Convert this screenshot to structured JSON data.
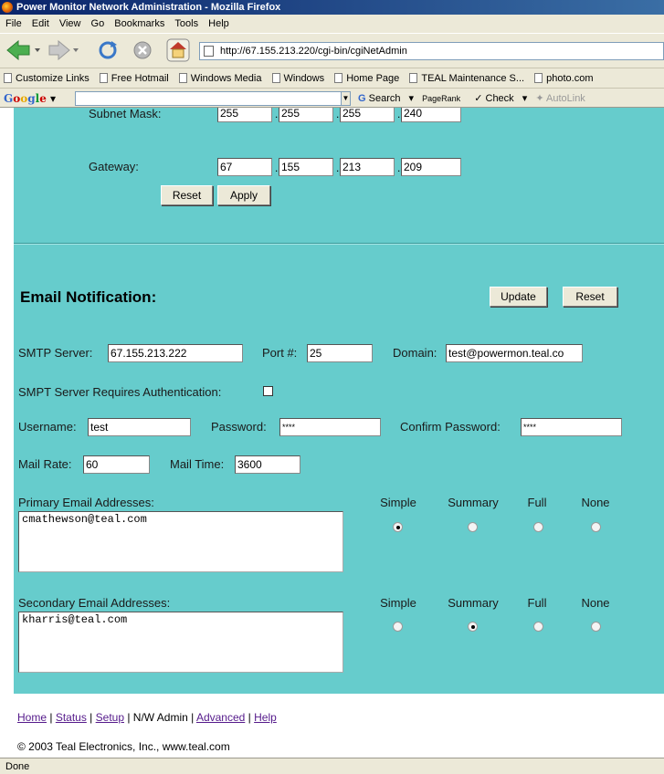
{
  "window": {
    "title": "Power Monitor Network Administration - Mozilla Firefox"
  },
  "menu": [
    "File",
    "Edit",
    "View",
    "Go",
    "Bookmarks",
    "Tools",
    "Help"
  ],
  "address": {
    "url": "http://67.155.213.220/cgi-bin/cgiNetAdmin"
  },
  "bookmarks": [
    "Customize Links",
    "Free Hotmail",
    "Windows Media",
    "Windows",
    "Home Page",
    "TEAL Maintenance S...",
    "photo.com"
  ],
  "googlebar": {
    "search": "Search",
    "pagerank": "PageRank",
    "check": "Check",
    "autolink": "AutoLink"
  },
  "network": {
    "subnet_label": "Subnet Mask:",
    "subnet": [
      "255",
      "255",
      "255",
      "240"
    ],
    "gateway_label": "Gateway:",
    "gateway": [
      "67",
      "155",
      "213",
      "209"
    ],
    "reset": "Reset",
    "apply": "Apply"
  },
  "email": {
    "title": "Email Notification:",
    "update": "Update",
    "reset": "Reset",
    "smtp_label": "SMTP Server:",
    "smtp": "67.155.213.222",
    "port_label": "Port #:",
    "port": "25",
    "domain_label": "Domain:",
    "domain": "test@powermon.teal.co",
    "auth_label": "SMPT Server Requires Authentication:",
    "auth_checked": false,
    "username_label": "Username:",
    "username": "test",
    "password_label": "Password:",
    "password": "****",
    "confirm_label": "Confirm Password:",
    "confirm": "****",
    "mailrate_label": "Mail Rate:",
    "mailrate": "60",
    "mailtime_label": "Mail Time:",
    "mailtime": "3600",
    "columns": [
      "Simple",
      "Summary",
      "Full",
      "None"
    ],
    "primary_label": "Primary Email Addresses:",
    "primary_value": "cmathewson@teal.com",
    "primary_selected": "Simple",
    "secondary_label": "Secondary Email Addresses:",
    "secondary_value": "kharris@teal.com",
    "secondary_selected": "Summary"
  },
  "footer": {
    "home": "Home",
    "status": "Status",
    "setup": "Setup",
    "nw_admin": "N/W Admin",
    "advanced": "Advanced",
    "help": "Help",
    "sep": " | ",
    "copyright": "© 2003 Teal Electronics, Inc., www.teal.com"
  },
  "status_bar": "Done"
}
